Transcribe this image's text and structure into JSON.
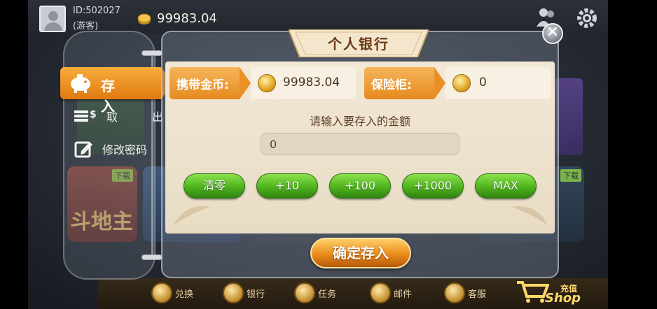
{
  "user": {
    "id": "ID:502027",
    "role": "(游客)",
    "gold": "99983.04"
  },
  "bank": {
    "title": "个人银行",
    "close_symbol": "✕",
    "tabs": [
      {
        "label": "存 入",
        "active": true
      },
      {
        "label": "取 出",
        "active": false
      },
      {
        "label": "修改密码",
        "active": false
      }
    ],
    "carry_label": "携带金币:",
    "carry_value": "99983.04",
    "safe_label": "保险柜:",
    "safe_value": "0",
    "prompt": "请输入要存入的金额",
    "amount_value": "0",
    "buttons": [
      "清零",
      "+10",
      "+100",
      "+1000",
      "MAX"
    ],
    "confirm_label": "确定存入"
  },
  "background": {
    "game_title_partial": "斗地主",
    "download_badge": "下载"
  },
  "bottom_nav": [
    {
      "label": "兑换",
      "icon": "exchange-icon"
    },
    {
      "label": "银行",
      "icon": "bank-icon"
    },
    {
      "label": "任务",
      "icon": "task-icon"
    },
    {
      "label": "邮件",
      "icon": "mail-icon"
    },
    {
      "label": "客服",
      "icon": "support-icon"
    }
  ],
  "shop": {
    "label": "充值",
    "sublabel": "Shop"
  },
  "colors": {
    "accent_orange": "#e98e1d",
    "green_button": "#4fb21d",
    "panel_cream": "#f2e8d6",
    "title_brown": "#6a3a14"
  }
}
